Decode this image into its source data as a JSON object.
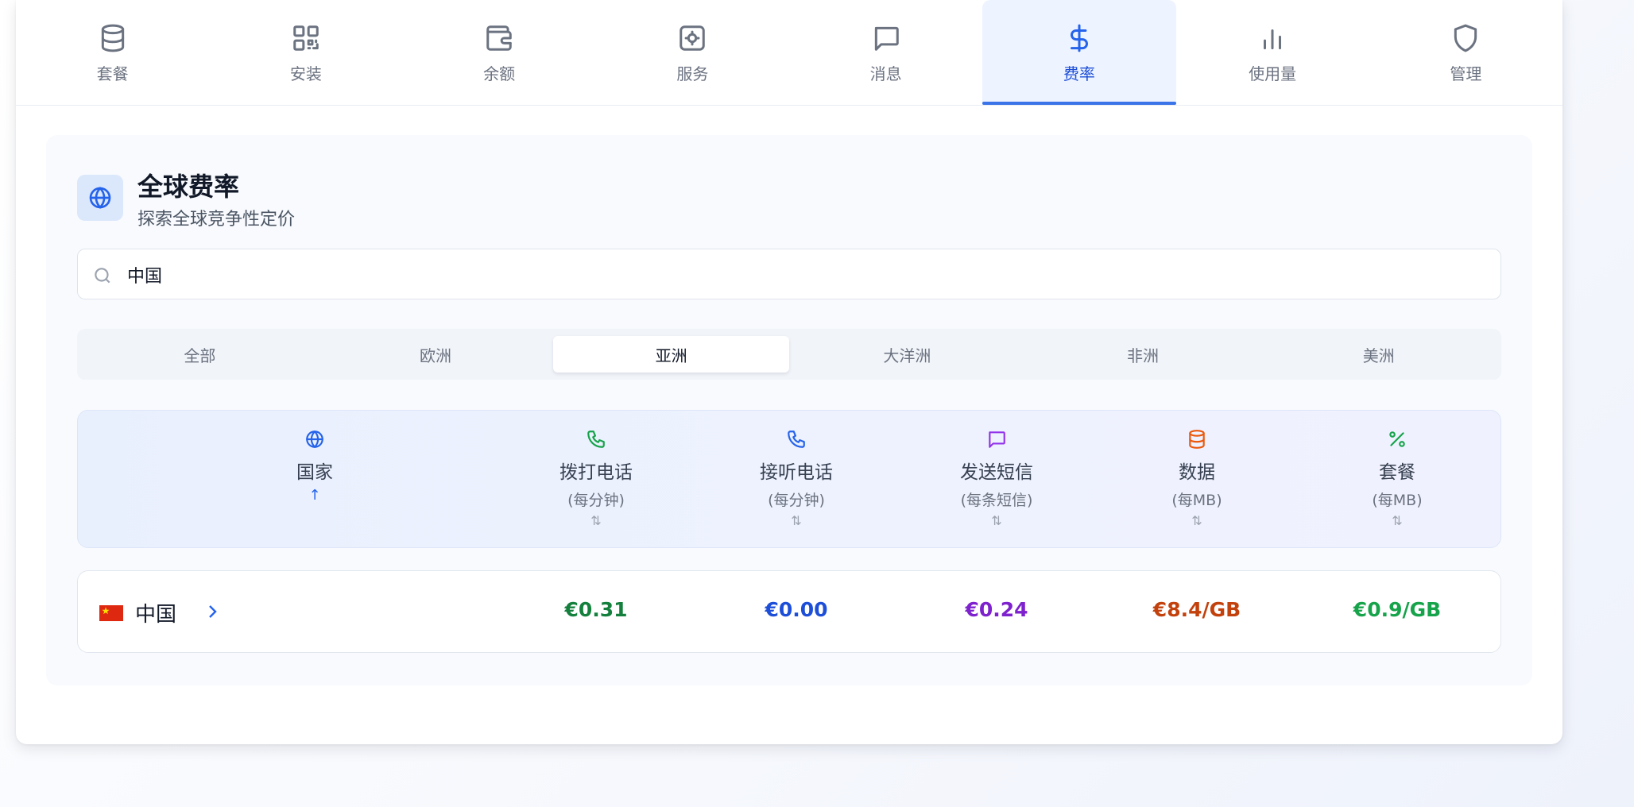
{
  "nav": {
    "items": [
      {
        "label": "套餐",
        "icon": "database-icon"
      },
      {
        "label": "安装",
        "icon": "qr-code-icon"
      },
      {
        "label": "余额",
        "icon": "wallet-icon"
      },
      {
        "label": "服务",
        "icon": "service-icon"
      },
      {
        "label": "消息",
        "icon": "message-icon"
      },
      {
        "label": "费率",
        "icon": "dollar-icon",
        "active": true
      },
      {
        "label": "使用量",
        "icon": "bar-chart-icon"
      },
      {
        "label": "管理",
        "icon": "shield-icon"
      }
    ]
  },
  "header": {
    "title": "全球费率",
    "subtitle": "探索全球竞争性定价",
    "icon": "globe-icon"
  },
  "search": {
    "value": "中国",
    "icon": "search-icon"
  },
  "regions": {
    "tabs": [
      "全部",
      "欧洲",
      "亚洲",
      "大洋洲",
      "非洲",
      "美洲"
    ],
    "active": "亚洲"
  },
  "table": {
    "columns": [
      {
        "name": "国家",
        "unit": "",
        "sort": "↑",
        "icon": "globe-icon",
        "color": "#2563eb"
      },
      {
        "name": "拨打电话",
        "unit": "(每分钟)",
        "sort": "⇅",
        "icon": "phone-icon",
        "color": "#16a34a"
      },
      {
        "name": "接听电话",
        "unit": "(每分钟)",
        "sort": "⇅",
        "icon": "phone-icon",
        "color": "#2563eb"
      },
      {
        "name": "发送短信",
        "unit": "(每条短信)",
        "sort": "⇅",
        "icon": "message-icon",
        "color": "#9333ea"
      },
      {
        "name": "数据",
        "unit": "(每MB)",
        "sort": "⇅",
        "icon": "database-icon",
        "color": "#ea580c"
      },
      {
        "name": "套餐",
        "unit": "(每MB)",
        "sort": "⇅",
        "icon": "percent-icon",
        "color": "#16a34a"
      }
    ],
    "rows": [
      {
        "country": "中国",
        "flag": "china-flag-icon",
        "outgoing_call": "€0.31",
        "incoming_call": "€0.00",
        "sms": "€0.24",
        "data": "€8.4/GB",
        "plan": "€0.9/GB"
      }
    ]
  },
  "colors": {
    "accent": "#2563eb",
    "outgoing": "#15803d",
    "incoming": "#1d4ed8",
    "sms": "#7e22ce",
    "data": "#c2410c",
    "plan": "#16a34a"
  }
}
